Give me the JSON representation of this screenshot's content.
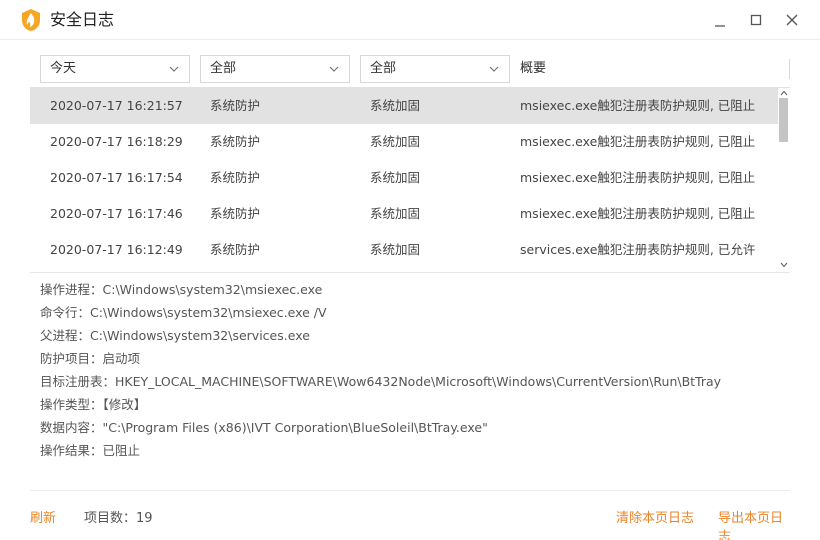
{
  "window": {
    "title": "安全日志",
    "logo_icon": "flame-shield-icon",
    "accent_color": "#e8852b"
  },
  "filters": {
    "time": {
      "selected": "今天"
    },
    "type": {
      "selected": "全部"
    },
    "category": {
      "selected": "全部"
    },
    "summary_header": "概要"
  },
  "rows": [
    {
      "time": "2020-07-17 16:21:57",
      "type": "系统防护",
      "category": "系统加固",
      "summary": "msiexec.exe触犯注册表防护规则, 已阻止",
      "selected": true
    },
    {
      "time": "2020-07-17 16:18:29",
      "type": "系统防护",
      "category": "系统加固",
      "summary": "msiexec.exe触犯注册表防护规则, 已阻止",
      "selected": false
    },
    {
      "time": "2020-07-17 16:17:54",
      "type": "系统防护",
      "category": "系统加固",
      "summary": "msiexec.exe触犯注册表防护规则, 已阻止",
      "selected": false
    },
    {
      "time": "2020-07-17 16:17:46",
      "type": "系统防护",
      "category": "系统加固",
      "summary": "msiexec.exe触犯注册表防护规则, 已阻止",
      "selected": false
    },
    {
      "time": "2020-07-17 16:12:49",
      "type": "系统防护",
      "category": "系统加固",
      "summary": "services.exe触犯注册表防护规则, 已允许",
      "selected": false
    }
  ],
  "details": {
    "process": "操作进程：C:\\Windows\\system32\\msiexec.exe",
    "command_line": "命令行：C:\\Windows\\system32\\msiexec.exe /V",
    "parent_process": "父进程：C:\\Windows\\system32\\services.exe",
    "protection_item": "防护项目：启动项",
    "target_registry": "目标注册表：HKEY_LOCAL_MACHINE\\SOFTWARE\\Wow6432Node\\Microsoft\\Windows\\CurrentVersion\\Run\\BtTray",
    "operation_type": "操作类型：【修改】",
    "data_content": "数据内容：\"C:\\Program Files (x86)\\IVT Corporation\\BlueSoleil\\BtTray.exe\"",
    "result": "操作结果：已阻止"
  },
  "footer": {
    "refresh": "刷新",
    "item_count": "项目数：19",
    "clear_page": "清除本页日志",
    "export_page": "导出本页日志"
  }
}
